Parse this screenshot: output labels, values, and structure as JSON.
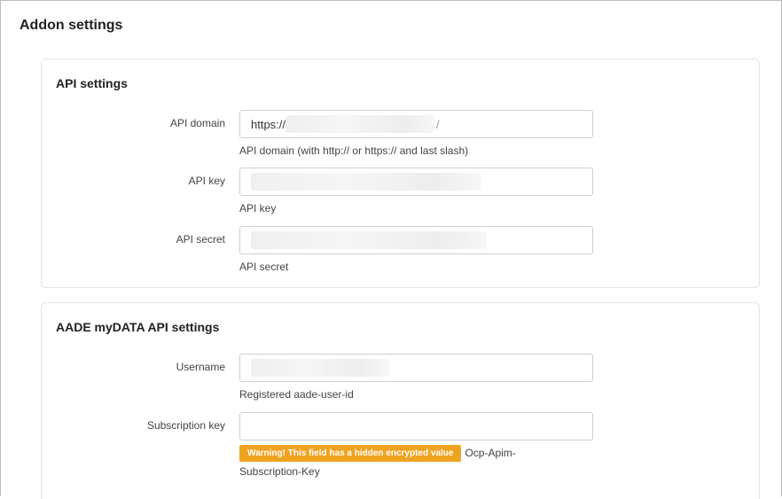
{
  "page": {
    "title": "Addon settings"
  },
  "api_settings": {
    "title": "API settings",
    "domain": {
      "label": "API domain",
      "value_prefix": "https://",
      "value_suffix": "/",
      "help": "API domain (with http:// or https:// and last slash)"
    },
    "key": {
      "label": "API key",
      "help": "API key"
    },
    "secret": {
      "label": "API secret",
      "help": "API secret"
    }
  },
  "aade_settings": {
    "title": "AADE myDATA API settings",
    "username": {
      "label": "Username",
      "help": "Registered aade-user-id"
    },
    "subscription_key": {
      "label": "Subscription key",
      "value": "",
      "warning": "Warning! This field has a hidden encrypted value",
      "help": "Ocp-Apim-Subscription-Key"
    }
  }
}
